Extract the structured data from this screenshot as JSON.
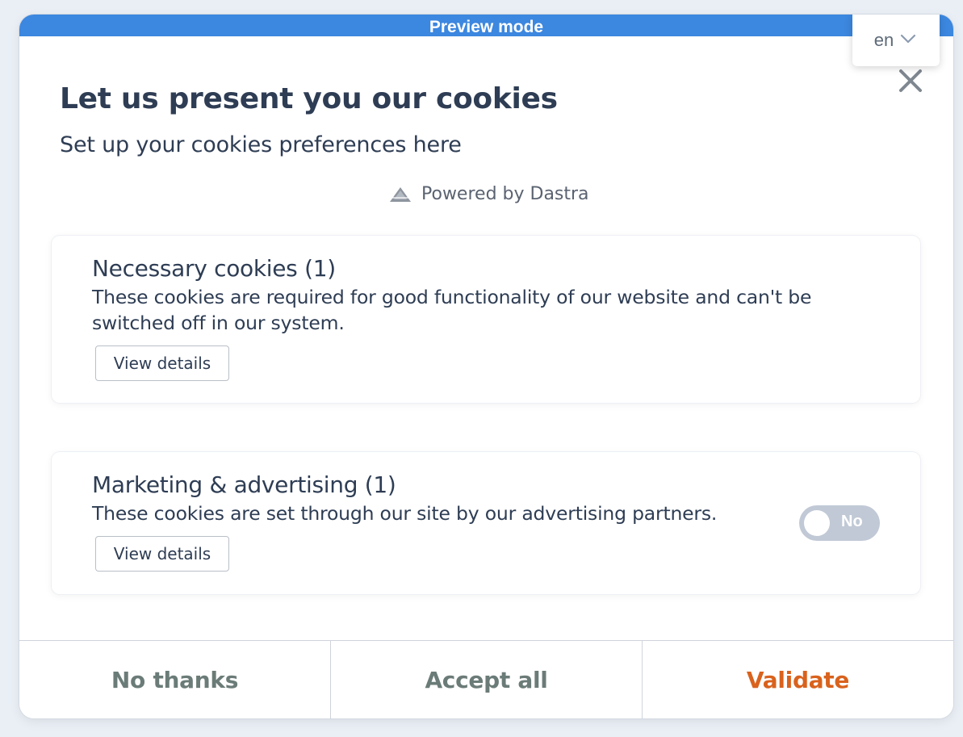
{
  "preview_bar": {
    "label": "Preview mode"
  },
  "language": {
    "current": "en"
  },
  "header": {
    "title": "Let us present you our cookies",
    "subtitle": "Set up your cookies preferences here",
    "powered_by": "Powered by Dastra"
  },
  "categories": [
    {
      "title": "Necessary cookies (1)",
      "description": "These cookies are required for good functionality of our website and can't be switched off in our system.",
      "details_label": "View details"
    },
    {
      "title": "Marketing & advertising (1)",
      "description": "These cookies are set through our site by our advertising partners.",
      "details_label": "View details",
      "toggle": {
        "label": "No",
        "enabled": false
      }
    }
  ],
  "footer": {
    "no_thanks": "No thanks",
    "accept_all": "Accept all",
    "validate": "Validate"
  },
  "colors": {
    "preview_bar": "#3c87df",
    "title_text": "#2e3d54",
    "validate_accent": "#d9621d",
    "secondary_button_text": "#6b7c78",
    "toggle_off": "#c1c9d6"
  },
  "icons": {
    "language_dropdown": "chevron-down-icon",
    "close": "close-icon",
    "powered_by": "dastra-logo-icon"
  }
}
